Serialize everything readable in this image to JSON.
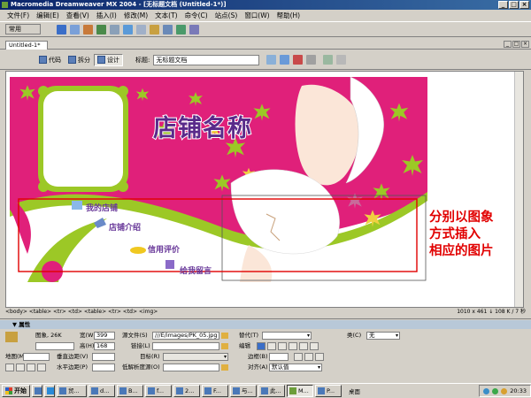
{
  "window": {
    "title": "Macromedia Dreamweaver MX 2004 - [无标题文档 (Untitled-1*)]",
    "controls": [
      "_",
      "□",
      "×"
    ]
  },
  "menu": [
    "文件(F)",
    "编辑(E)",
    "查看(V)",
    "插入(I)",
    "修改(M)",
    "文本(T)",
    "命令(C)",
    "站点(S)",
    "窗口(W)",
    "帮助(H)"
  ],
  "toolbar": {
    "category": "常用"
  },
  "document": {
    "tab_label": "Untitled-1*",
    "views": {
      "code": "代码",
      "split": "拆分",
      "design": "设计"
    },
    "title_label": "标题:",
    "title_value": "无标题文档"
  },
  "banner": {
    "shop_name": "店铺名称",
    "nav": [
      "我的店铺",
      "店铺介绍",
      "信用评价",
      "给我留言"
    ]
  },
  "annotation": [
    "分别以图象",
    "方式插入",
    "相应的图片"
  ],
  "status": {
    "tag_path": "<body> <table> <tr> <td> <table> <tr> <td> <img>",
    "info": "1010 x 461 ↓ 108 K / 7 秒"
  },
  "properties": {
    "header": "▼ 属性",
    "image_label": "图象, 26K",
    "width_label": "宽(W)",
    "width_value": "399",
    "height_label": "高(H)",
    "height_value": "168",
    "src_label": "源文件(S)",
    "src_value": "///E/images/PK_05.jpg",
    "link_label": "链接(L)",
    "alt_label": "替代(T)",
    "class_label": "类(C)",
    "class_value": "无",
    "edit_label": "编辑",
    "map_label": "地图(M)",
    "vspace_label": "垂直边距(V)",
    "target_label": "目标(R)",
    "border_label": "边框(B)",
    "hspace_label": "水平边距(P)",
    "lowsrc_label": "低解析度源(O)",
    "align_label": "对齐(A)",
    "align_value": "默认值"
  },
  "taskbar": {
    "start": "开始",
    "tasks": [
      "贸...",
      "d...",
      "B...",
      "f...",
      "2...",
      "F...",
      "与...",
      "此...",
      "M...",
      "P..."
    ],
    "active_index": 8,
    "desktop": "桌面",
    "clock": "20:33"
  },
  "colors": {
    "banner_pink": "#e0207a",
    "leaf_green": "#9cc826",
    "shop_name_purple": "#5a2a8a",
    "annotation_red": "#e10000"
  }
}
